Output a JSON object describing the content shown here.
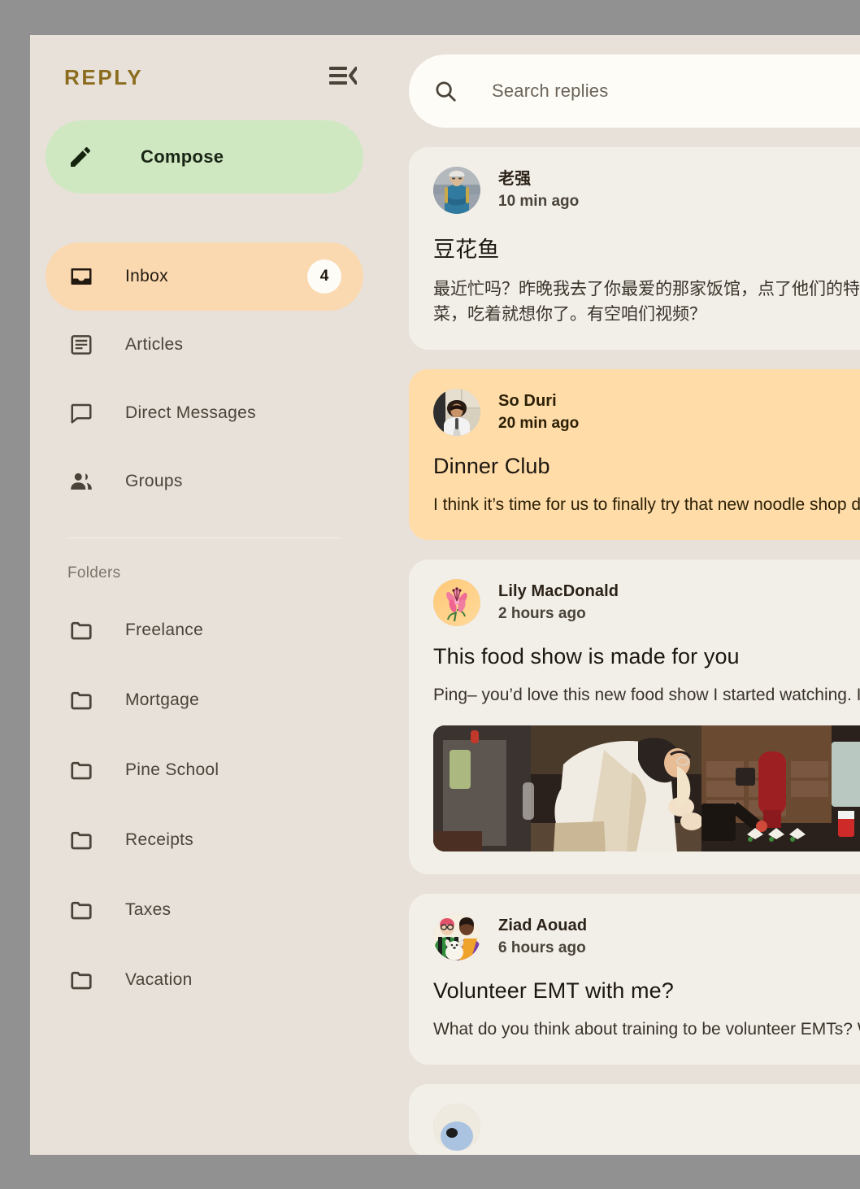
{
  "sidebar": {
    "brand": "REPLY",
    "menu_icon": "menu-collapse-icon",
    "compose": {
      "label": "Compose",
      "icon": "pencil-icon"
    },
    "nav_items": [
      {
        "label": "Inbox",
        "icon": "inbox-icon",
        "badge": "4",
        "active": true
      },
      {
        "label": "Articles",
        "icon": "article-icon",
        "badge": "",
        "active": false
      },
      {
        "label": "Direct Messages",
        "icon": "chat-bubble-icon",
        "badge": "",
        "active": false
      },
      {
        "label": "Groups",
        "icon": "people-icon",
        "badge": "",
        "active": false
      }
    ],
    "folders_label": "Folders",
    "folders": [
      {
        "label": "Freelance",
        "icon": "folder-icon"
      },
      {
        "label": "Mortgage",
        "icon": "folder-icon"
      },
      {
        "label": "Pine School",
        "icon": "folder-icon"
      },
      {
        "label": "Receipts",
        "icon": "folder-icon"
      },
      {
        "label": "Taxes",
        "icon": "folder-icon"
      },
      {
        "label": "Vacation",
        "icon": "folder-icon"
      }
    ]
  },
  "search": {
    "placeholder": "Search replies",
    "value": "",
    "icon": "search-icon"
  },
  "emails": [
    {
      "sender": "老强",
      "time": "10 min ago",
      "subject": "豆花鱼",
      "body": "最近忙吗？昨晚我去了你最爱的那家饭馆，点了他们的特色菜，吃着就想你了。有空咱们视频？",
      "avatar": "photo-man-blue-shirt",
      "highlight": false,
      "has_image": false
    },
    {
      "sender": "So Duri",
      "time": "20 min ago",
      "subject": "Dinner Club",
      "body": "I think it’s time for us to finally try that new noodle shop downtown that doesn’t use menus. Anyone else have other suggestions for dinner?",
      "avatar": "photo-person-white-top",
      "highlight": true,
      "has_image": false
    },
    {
      "sender": "Lily MacDonald",
      "time": "2 hours ago",
      "subject": "This food show is made for you",
      "body": "Ping– you’d love this new food show I started watching. It’s produced by a Thai drummer who started getting recognized for the amazing food.",
      "avatar": "illustration-pink-lily-flower",
      "highlight": false,
      "has_image": true,
      "image_alt": "chef-preparing-food-in-kitchen"
    },
    {
      "sender": "Ziad Aouad",
      "time": "6 hours ago",
      "subject": "Volunteer EMT with me?",
      "body": "What do you think about training to be volunteer EMTs? We could do it together for moral support. Think about it??",
      "avatar": "illustration-two-people-with-dog",
      "highlight": false,
      "has_image": false
    },
    {
      "sender": "",
      "time": "",
      "subject": "",
      "body": "",
      "avatar": "photo-partial",
      "highlight": false,
      "has_image": false
    }
  ],
  "colors": {
    "backdrop": "#919191",
    "sidebar_bg": "#E8E1D9",
    "card_bg": "#F2EFE9",
    "card_highlight_bg": "#FFDCA8",
    "compose_bg": "#CFE8C2",
    "nav_active_bg": "#FAD8B0",
    "brand_color": "#8C6D1F",
    "search_bg": "#FDFCF7"
  }
}
